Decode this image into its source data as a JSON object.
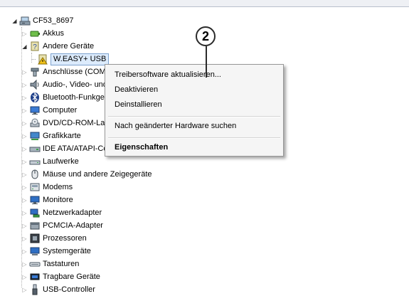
{
  "tree": {
    "root": {
      "label": "CF53_8697",
      "icon": "computer-icon"
    },
    "items": [
      {
        "key": "akkus",
        "label": "Akkus",
        "icon": "battery-icon"
      },
      {
        "key": "andere",
        "label": "Andere Geräte",
        "icon": "unknown-device-icon"
      },
      {
        "key": "weasy",
        "label": "W.EASY+ USB",
        "icon": "warning-device-icon"
      },
      {
        "key": "anschluesse",
        "label": "Anschlüsse (COM & LPT)",
        "icon": "port-icon"
      },
      {
        "key": "audio",
        "label": "Audio-, Video- und Gamecontroller",
        "icon": "speaker-icon"
      },
      {
        "key": "bluetooth",
        "label": "Bluetooth-Funkgeräte",
        "icon": "bluetooth-icon"
      },
      {
        "key": "computer",
        "label": "Computer",
        "icon": "monitor-icon"
      },
      {
        "key": "dvd",
        "label": "DVD/CD-ROM-Laufwerke",
        "icon": "dvd-drive-icon"
      },
      {
        "key": "grafik",
        "label": "Grafikkarte",
        "icon": "display-adapter-icon"
      },
      {
        "key": "ide",
        "label": "IDE ATA/ATAPI-Controller",
        "icon": "ide-controller-icon"
      },
      {
        "key": "laufwerke",
        "label": "Laufwerke",
        "icon": "disk-drive-icon"
      },
      {
        "key": "maeuse",
        "label": "Mäuse und andere Zeigegeräte",
        "icon": "mouse-icon"
      },
      {
        "key": "modems",
        "label": "Modems",
        "icon": "modem-icon"
      },
      {
        "key": "monitore",
        "label": "Monitore",
        "icon": "monitor-icon"
      },
      {
        "key": "netzwerk",
        "label": "Netzwerkadapter",
        "icon": "network-adapter-icon"
      },
      {
        "key": "pcmcia",
        "label": "PCMCIA-Adapter",
        "icon": "pcmcia-icon"
      },
      {
        "key": "prozessoren",
        "label": "Prozessoren",
        "icon": "processor-icon"
      },
      {
        "key": "system",
        "label": "Systemgeräte",
        "icon": "system-device-icon"
      },
      {
        "key": "tastaturen",
        "label": "Tastaturen",
        "icon": "keyboard-icon"
      },
      {
        "key": "tragbare",
        "label": "Tragbare Geräte",
        "icon": "portable-device-icon"
      },
      {
        "key": "usb",
        "label": "USB-Controller",
        "icon": "usb-icon"
      }
    ]
  },
  "context_menu": {
    "update_driver": "Treibersoftware aktualisieren...",
    "disable": "Deaktivieren",
    "uninstall": "Deinstallieren",
    "scan_hardware": "Nach geänderter Hardware suchen",
    "properties": "Eigenschaften"
  },
  "callout": {
    "number": "2"
  }
}
